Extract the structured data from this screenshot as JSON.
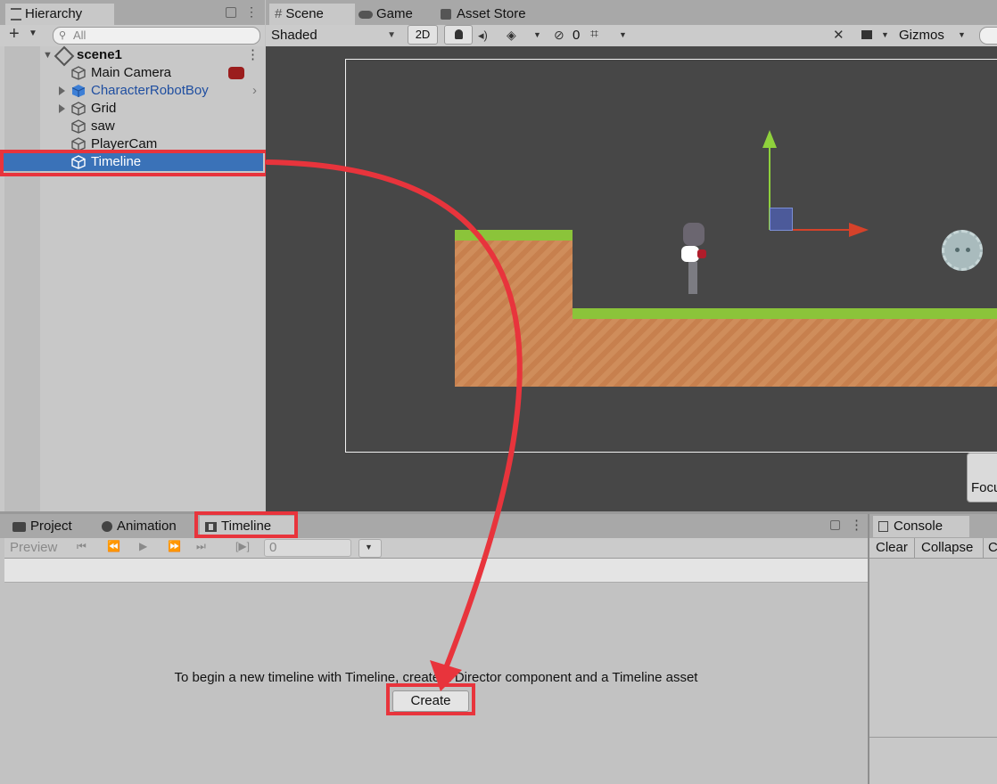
{
  "hierarchy": {
    "tab_label": "Hierarchy",
    "search_placeholder": "All",
    "scene_name": "scene1",
    "items": [
      {
        "label": "Main Camera"
      },
      {
        "label": "CharacterRobotBoy"
      },
      {
        "label": "Grid"
      },
      {
        "label": "saw"
      },
      {
        "label": "PlayerCam"
      },
      {
        "label": "Timeline"
      }
    ]
  },
  "scene_tabs": {
    "scene": "Scene",
    "game": "Game",
    "asset_store": "Asset Store"
  },
  "scene_toolbar": {
    "shading": "Shaded",
    "mode_2d": "2D",
    "hidden_count": "0",
    "gizmos": "Gizmos",
    "focus_label": "Focu"
  },
  "bottom_tabs": {
    "project": "Project",
    "animation": "Animation",
    "timeline": "Timeline"
  },
  "timeline_toolbar": {
    "preview": "Preview",
    "frame_value": "0"
  },
  "timeline_panel": {
    "message": "To begin a new timeline with Timeline, create a Director component and a Timeline asset",
    "create_label": "Create"
  },
  "console": {
    "tab_label": "Console",
    "clear": "Clear",
    "collapse": "Collapse",
    "c": "C"
  },
  "colors": {
    "highlight": "#e8343c",
    "selection": "#3a72b8",
    "scene_bg": "#474747",
    "grass": "#8bc43a",
    "dirt": "#cf8d5b"
  }
}
